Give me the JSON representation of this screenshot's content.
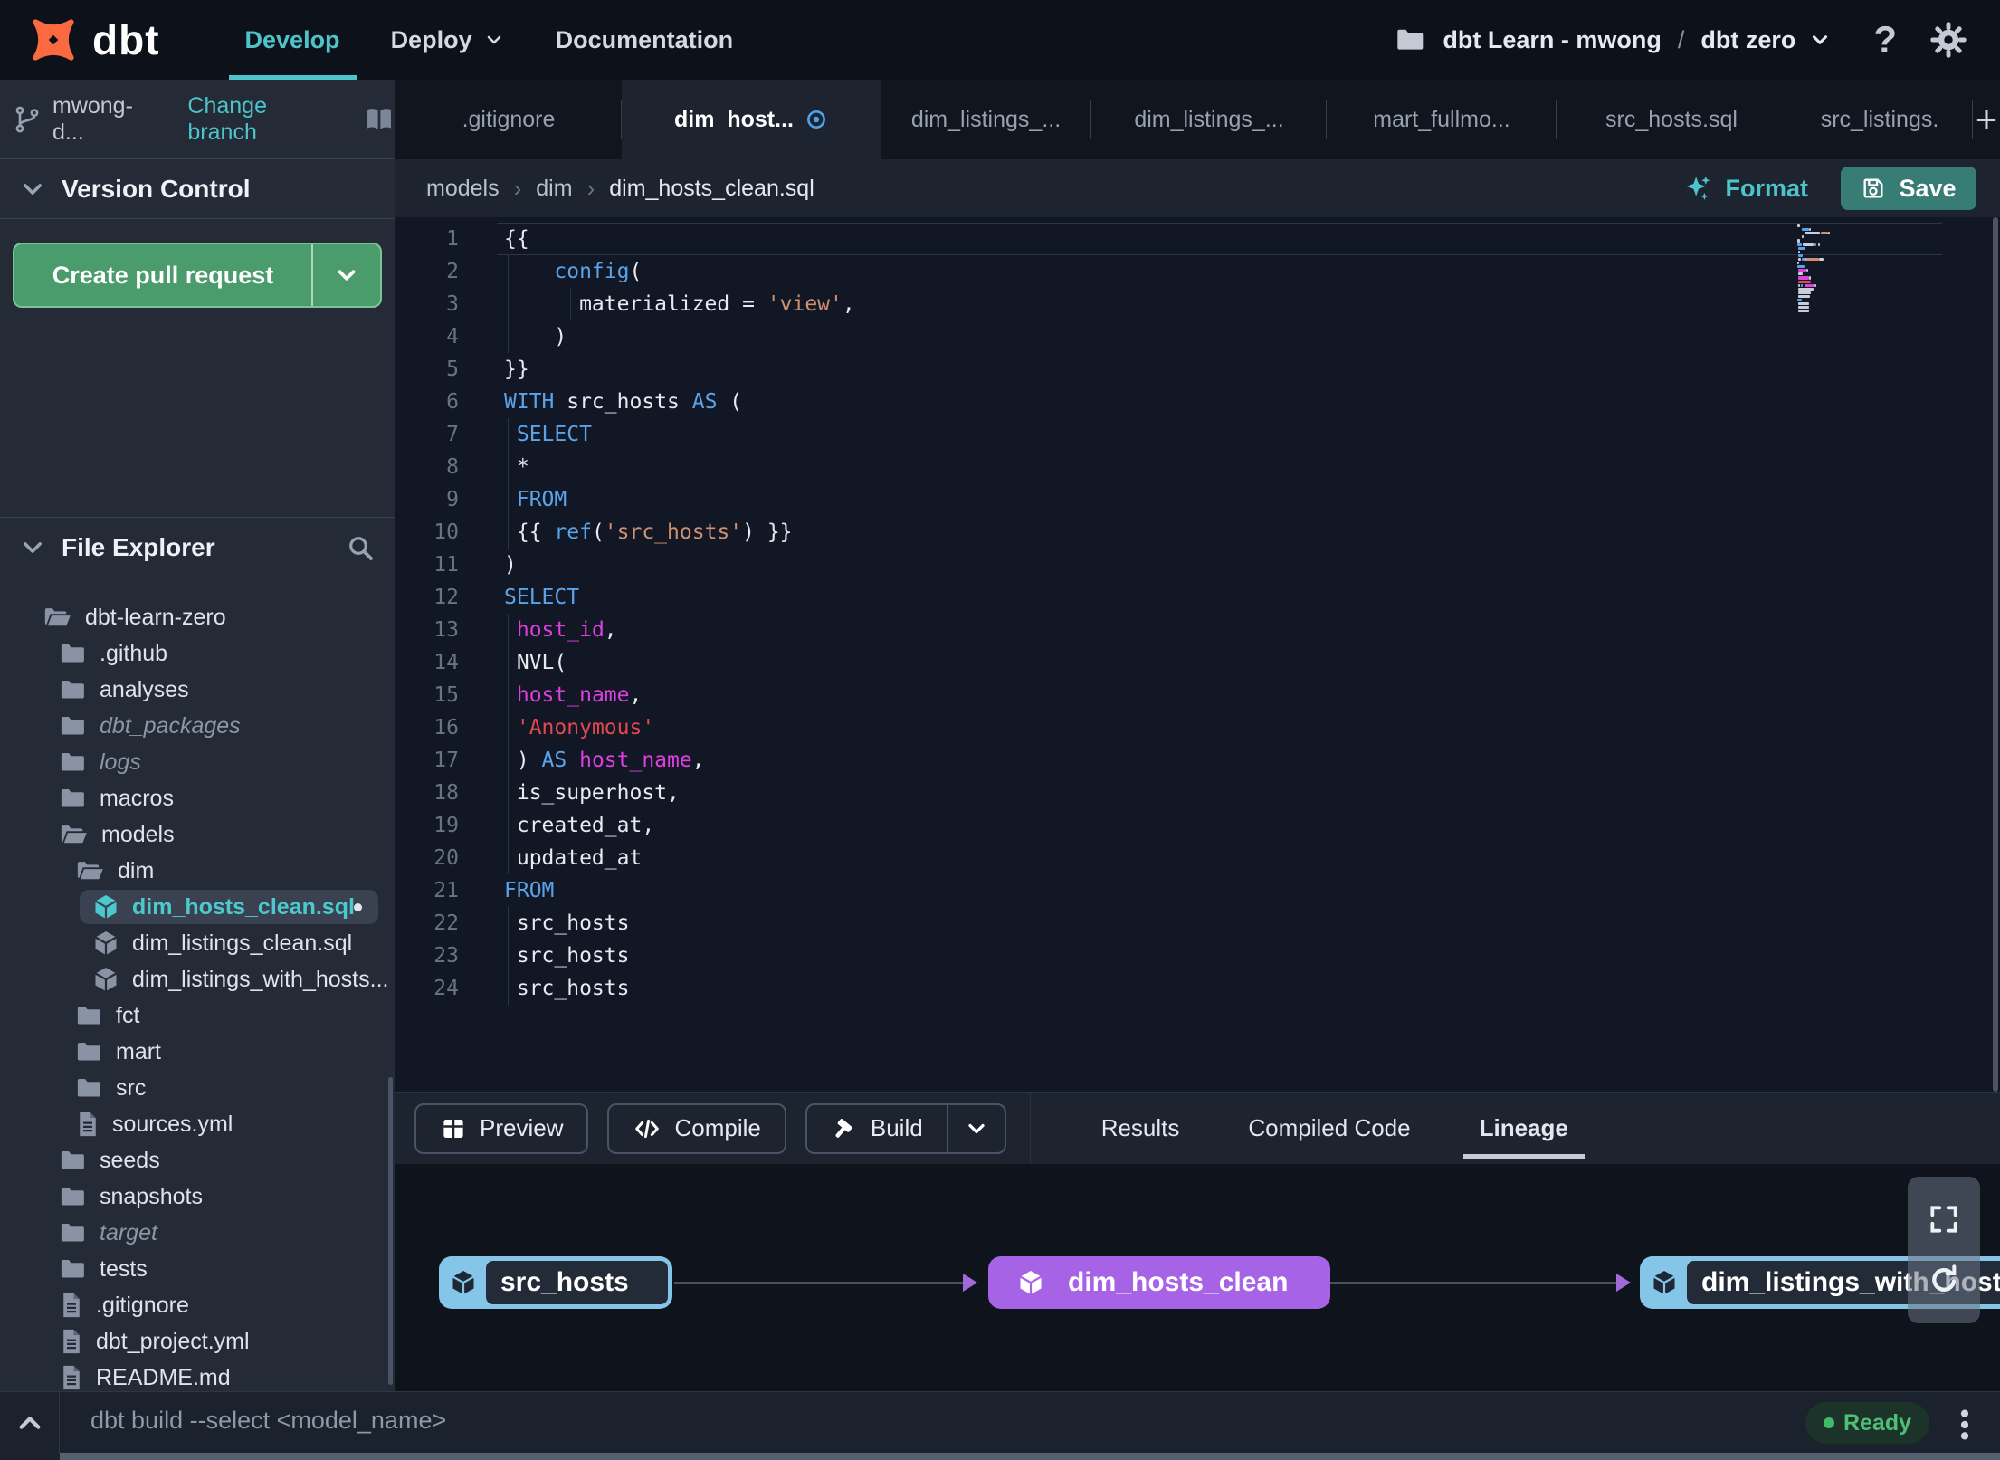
{
  "topnav": {
    "brand": "dbt",
    "nav": {
      "develop": "Develop",
      "deploy": "Deploy",
      "documentation": "Documentation"
    },
    "project": {
      "account": "dbt Learn - mwong",
      "separator": "/",
      "environment": "dbt zero"
    }
  },
  "branch_bar": {
    "branch": "mwong-d...",
    "change_branch": "Change branch"
  },
  "tabs": [
    {
      "label": ".gitignore",
      "active": false,
      "modified": false
    },
    {
      "label": "dim_host...",
      "active": true,
      "modified": true
    },
    {
      "label": "dim_listings_...",
      "active": false,
      "modified": false
    },
    {
      "label": "dim_listings_...",
      "active": false,
      "modified": false
    },
    {
      "label": "mart_fullmo...",
      "active": false,
      "modified": false
    },
    {
      "label": "src_hosts.sql",
      "active": false,
      "modified": false
    },
    {
      "label": "src_listings.",
      "active": false,
      "modified": false
    }
  ],
  "version_control": {
    "title": "Version Control",
    "create_pr": "Create pull request"
  },
  "file_explorer": {
    "title": "File Explorer",
    "items": [
      {
        "label": "dbt-learn-zero",
        "icon": "folder-open",
        "depth": 0
      },
      {
        "label": ".github",
        "icon": "folder",
        "depth": 1
      },
      {
        "label": "analyses",
        "icon": "folder",
        "depth": 1
      },
      {
        "label": "dbt_packages",
        "icon": "folder",
        "depth": 1,
        "italic": true
      },
      {
        "label": "logs",
        "icon": "folder",
        "depth": 1,
        "italic": true
      },
      {
        "label": "macros",
        "icon": "folder",
        "depth": 1
      },
      {
        "label": "models",
        "icon": "folder-open",
        "depth": 1
      },
      {
        "label": "dim",
        "icon": "folder-open",
        "depth": 2
      },
      {
        "label": "dim_hosts_clean.sql",
        "icon": "model",
        "depth": 3,
        "selected": true,
        "modified": true
      },
      {
        "label": "dim_listings_clean.sql",
        "icon": "model",
        "depth": 3
      },
      {
        "label": "dim_listings_with_hosts...",
        "icon": "model",
        "depth": 3
      },
      {
        "label": "fct",
        "icon": "folder",
        "depth": 2
      },
      {
        "label": "mart",
        "icon": "folder",
        "depth": 2
      },
      {
        "label": "src",
        "icon": "folder",
        "depth": 2
      },
      {
        "label": "sources.yml",
        "icon": "file",
        "depth": 2
      },
      {
        "label": "seeds",
        "icon": "folder",
        "depth": 1
      },
      {
        "label": "snapshots",
        "icon": "folder",
        "depth": 1
      },
      {
        "label": "target",
        "icon": "folder",
        "depth": 1,
        "italic": true
      },
      {
        "label": "tests",
        "icon": "folder",
        "depth": 1
      },
      {
        "label": ".gitignore",
        "icon": "file",
        "depth": 1
      },
      {
        "label": "dbt_project.yml",
        "icon": "file",
        "depth": 1
      },
      {
        "label": "README.md",
        "icon": "file",
        "depth": 1
      }
    ]
  },
  "editor": {
    "breadcrumb": [
      "models",
      "dim",
      "dim_hosts_clean.sql"
    ],
    "format": "Format",
    "save": "Save",
    "lines": [
      [
        [
          "{{",
          "plain"
        ]
      ],
      [
        [
          "    ",
          "plain"
        ],
        [
          "config",
          "kw"
        ],
        [
          "(",
          "plain"
        ]
      ],
      [
        [
          "      materialized = ",
          "plain"
        ],
        [
          "'view'",
          "str"
        ],
        [
          ",",
          "plain"
        ]
      ],
      [
        [
          "    )",
          "plain"
        ]
      ],
      [
        [
          "}}",
          "plain"
        ]
      ],
      [
        [
          "WITH",
          "kw"
        ],
        [
          " src_hosts ",
          "plain"
        ],
        [
          "AS",
          "kw"
        ],
        [
          " (",
          "plain"
        ]
      ],
      [
        [
          " ",
          "plain"
        ],
        [
          "SELECT",
          "kw"
        ]
      ],
      [
        [
          " *",
          "plain"
        ]
      ],
      [
        [
          " ",
          "plain"
        ],
        [
          "FROM",
          "kw"
        ]
      ],
      [
        [
          " {{ ",
          "plain"
        ],
        [
          "ref",
          "kw"
        ],
        [
          "(",
          "plain"
        ],
        [
          "'src_hosts'",
          "str"
        ],
        [
          ") }}",
          "plain"
        ]
      ],
      [
        [
          ")",
          "plain"
        ]
      ],
      [
        [
          "SELECT",
          "kw"
        ]
      ],
      [
        [
          " ",
          "plain"
        ],
        [
          "host_id",
          "ident"
        ],
        [
          ",",
          "plain"
        ]
      ],
      [
        [
          " NVL(",
          "plain"
        ]
      ],
      [
        [
          " ",
          "plain"
        ],
        [
          "host_name",
          "ident"
        ],
        [
          ",",
          "plain"
        ]
      ],
      [
        [
          " ",
          "plain"
        ],
        [
          "'Anonymous'",
          "str2"
        ]
      ],
      [
        [
          " ) ",
          "plain"
        ],
        [
          "AS",
          "kw"
        ],
        [
          " ",
          "plain"
        ],
        [
          "host_name",
          "ident"
        ],
        [
          ",",
          "plain"
        ]
      ],
      [
        [
          " is_superhost,",
          "plain"
        ]
      ],
      [
        [
          " created_at,",
          "plain"
        ]
      ],
      [
        [
          " updated_at",
          "plain"
        ]
      ],
      [
        [
          "FROM",
          "kw"
        ]
      ],
      [
        [
          " src_hosts",
          "plain"
        ]
      ],
      [
        [
          " src_hosts",
          "plain"
        ]
      ],
      [
        [
          " src_hosts",
          "plain"
        ]
      ]
    ]
  },
  "code_colors": {
    "kw": "#5aa3e8",
    "ident": "#de3fde",
    "str": "#d0906f",
    "str2": "#e4484f",
    "plain": "#e8eaef"
  },
  "bottom_panel": {
    "preview": "Preview",
    "compile": "Compile",
    "build": "Build",
    "tabs": [
      "Results",
      "Compiled Code",
      "Lineage"
    ],
    "active_tab": "Lineage"
  },
  "lineage": {
    "nodes": [
      {
        "label": "src_hosts",
        "variant": "source"
      },
      {
        "label": "dim_hosts_clean",
        "variant": "selected"
      },
      {
        "label": "dim_listings_with_hosts",
        "variant": "source"
      }
    ]
  },
  "status_bar": {
    "command": "dbt build --select <model_name>",
    "status": "Ready"
  },
  "colors": {
    "teal": "#4cc4ca",
    "green": "#4a9c6d",
    "save_teal": "#377c75",
    "purple": "#a763e6",
    "node_blue": "#85c6e8",
    "ready_green": "#4fbe77",
    "brand_orange": "#fa6940",
    "modified_blue": "#4da3ea"
  }
}
